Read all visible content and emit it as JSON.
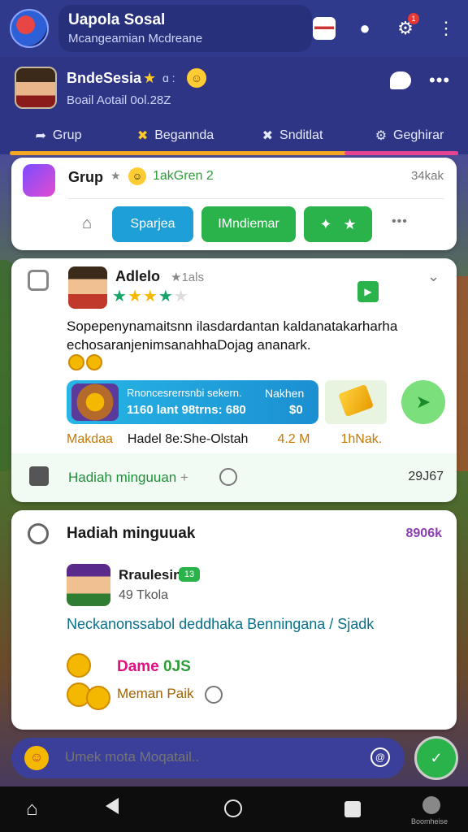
{
  "header": {
    "title": "Uapola Sosal",
    "subtitle": "Mcangeamian Mcdreane",
    "badge_count": "1"
  },
  "profile": {
    "name": "BndeSesia",
    "extra": "ɑ :",
    "meta": "Boail Aotail 0ol.28Z"
  },
  "tabs": [
    {
      "label": "Grup",
      "icon": "share-icon"
    },
    {
      "label": "Begannda",
      "icon": "cross-icon"
    },
    {
      "label": "Snditlat",
      "icon": "puzzle-icon"
    },
    {
      "label": "Geghirar",
      "icon": "gear-icon"
    }
  ],
  "group": {
    "label": "Grup",
    "tag": "1akGren 2",
    "count": "34kak",
    "buttons": [
      "Sparjea",
      "IMndiemar"
    ]
  },
  "post": {
    "author": "Adlelo",
    "time": "1als",
    "text": "Sopepenynamaitsnn ilasdardantan kaldanatakarharha echosaranjenimsanahhaDojag ananark.",
    "promo_line1": "Rnoncesrerrsnbi sekern.",
    "promo_line2": "1160 lant 98trns: 680",
    "promo_right1": "Nakhen",
    "promo_right2": "$0",
    "meta": [
      "Makdaa",
      "Hadel 8e:She-Olstah",
      "4.2 M",
      "1hNak."
    ],
    "footer_label": "Hadiah minguuan",
    "footer_extra": "+",
    "footer_count": "29J67"
  },
  "reward": {
    "title": "Hadiah minguuak",
    "code": "8906k",
    "user_name": "Rraulesin",
    "user_badge": "13",
    "user_sub": "49 Tkola",
    "desc": "Neckanonssabol deddhaka Benningana / Sjadk",
    "amount_a": "Dame",
    "amount_b": "0JS",
    "name": "Meman Paik"
  },
  "composer": {
    "placeholder": "Umek mota Moqatail.."
  },
  "sysnav": {
    "account_label": "Boomheise"
  },
  "colors": {
    "header": "#303a8c",
    "accent_green": "#2ab34a",
    "accent_blue": "#1e9fd8",
    "accent_pink": "#e84393"
  }
}
